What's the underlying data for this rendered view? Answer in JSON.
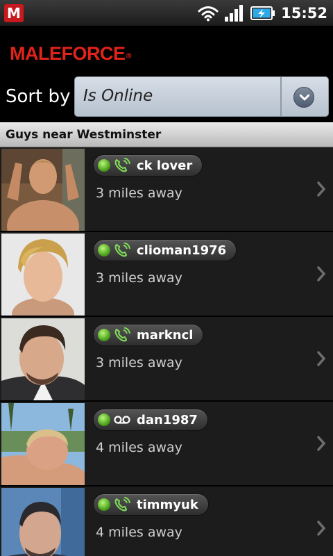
{
  "status_bar": {
    "app_icon_letter": "M",
    "time": "15:52",
    "icons": [
      "wifi-icon",
      "signal-icon",
      "battery-charging-icon"
    ]
  },
  "header": {
    "brand": "MALEFORCE",
    "brand_mark": "®",
    "brand_color": "#e2231a"
  },
  "sort": {
    "label": "Sort by",
    "selected": "Is Online"
  },
  "section": {
    "title": "Guys near Westminster"
  },
  "colors": {
    "online_green": "#4fa61e",
    "list_bg": "#1c1c1c",
    "select_bg": "#c7d0da"
  },
  "users": [
    {
      "name": "ck lover",
      "distance": "3 miles away",
      "status_icon": "phone-icon"
    },
    {
      "name": "clioman1976",
      "distance": "3 miles away",
      "status_icon": "phone-icon"
    },
    {
      "name": "markncl",
      "distance": "3 miles away",
      "status_icon": "phone-icon"
    },
    {
      "name": "dan1987",
      "distance": "4 miles away",
      "status_icon": "voicemail-icon"
    },
    {
      "name": "timmyuk",
      "distance": "4 miles away",
      "status_icon": "phone-icon"
    }
  ]
}
